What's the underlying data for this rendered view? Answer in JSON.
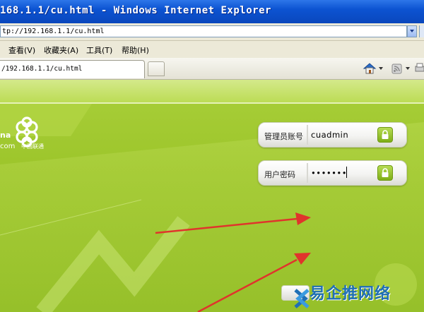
{
  "window": {
    "title": "168.1.1/cu.html - Windows Internet Explorer"
  },
  "address_bar": {
    "value": "tp://192.168.1.1/cu.html"
  },
  "menu": {
    "items": [
      {
        "label": "查看(V)"
      },
      {
        "label": "收藏夹(A)"
      },
      {
        "label": "工具(T)"
      },
      {
        "label": "帮助(H)"
      }
    ]
  },
  "tabs": {
    "active_label": "/192.168.1.1/cu.html"
  },
  "logo": {
    "line1": "na",
    "line2": "com",
    "line2_cn": "中国联通"
  },
  "login": {
    "account_label": "管理员账号",
    "account_value": "cuadmin",
    "password_label": "用户密码",
    "password_value": "•••••••"
  },
  "watermark": {
    "text": "易企推网络"
  },
  "colors": {
    "accent_green": "#9cc52a",
    "arrow_red": "#e0342c",
    "watermark_blue": "#1f6fb5"
  }
}
